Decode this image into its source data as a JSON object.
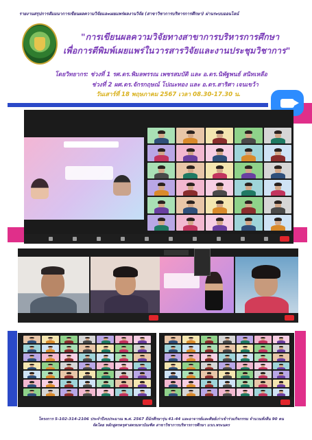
{
  "header": {
    "caption": "รายงานสรุปการสัมมนาการเขียนผลความวิจัยและเผยแพร่ผลงานวิจัย (สาขาวิชาการบริหารการศึกษา) ผ่านระบบออนไลน์",
    "title_line1": "\"การเขียนผลความวิจัยทางสาขาการบริหารการศึกษา",
    "title_line2": "เพื่อการตีพิมพ์เผยแพร่ในวารสารวิจัยและงานประชุมวิชาการ\"",
    "speakers_line1": "โดยวิทยากร: ช่วงที่ 1 รศ.ดร.พิมลพรรณ เพชรสมบัติ และ อ.ดร.นิพัฐพนธ์ สนิทเหลือ",
    "speakers_line2": "ช่วงที่ 2 ผศ.ดร.จักรกฤษณ์ โปณะทอง และ อ.ดร.สาริศา เจนเขว้า",
    "date_line": "วันเสาร์ที่ 18 พฤษภาคม 2567 เวลา 08.30-17.30 น."
  },
  "colors": {
    "title_purple": "#7a3cb8",
    "date_gold": "#d9b11d",
    "band_blue": "#2b49c8",
    "band_pink": "#e02f8a",
    "zoom_blue": "#2d8cff"
  },
  "icons": {
    "logo": "university-seal-icon",
    "zoom": "zoom-camera-icon"
  },
  "footer": {
    "line1": "โครงการ 5-102-314-2106 ประจำปีงบประมาณ พ.ศ. 2567 มีนักศึกษารุ่น 41-44 และอาจารย์และศิษย์เก่าเข้าร่วมกิจกรรม จำนวนทั้งสิ้น 90 คน",
    "line2": "จัดโดย หลักสูตรครุศาสตรมหาบัณฑิต สาขาวิชาการบริหารการศึกษา มรภ.พระนคร"
  }
}
